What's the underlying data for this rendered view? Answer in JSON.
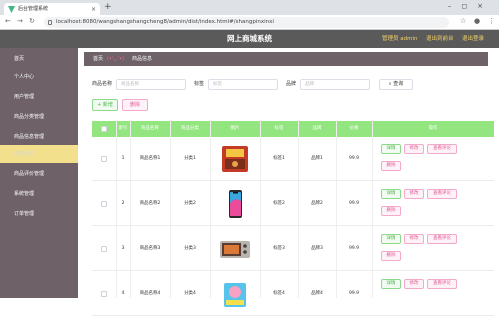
{
  "browser": {
    "tab_title": "后台管理系统",
    "url": "localhost:8080/wangshangshangcheng8/admin/dist/index.html#/shangpinxinxi"
  },
  "header": {
    "title": "网上商城系统",
    "user_label": "管理员 admin",
    "exit_to_front": "退出到前台",
    "logout": "退出登录"
  },
  "sidebar": {
    "items": [
      {
        "label": "首页"
      },
      {
        "label": "个人中心"
      },
      {
        "label": "用户管理"
      },
      {
        "label": "商品分类管理"
      },
      {
        "label": "商品信息管理"
      },
      {
        "label": "商品信息"
      },
      {
        "label": "商品评价管理"
      },
      {
        "label": "系统管理"
      },
      {
        "label": "订单管理"
      }
    ]
  },
  "breadcrumb": {
    "home": "首页",
    "separator": "(•'◡'•)",
    "current": "商品信息"
  },
  "search": {
    "name_label": "商品名称",
    "name_placeholder": "商品名称",
    "tag_label": "标签",
    "tag_placeholder": "标签",
    "brand_label": "品牌",
    "brand_placeholder": "品牌",
    "query_button": "查询"
  },
  "actions": {
    "add": "+ 新增",
    "delete": "删除"
  },
  "table": {
    "headers": [
      "索引",
      "商品名称",
      "商品分类",
      "图片",
      "标签",
      "品牌",
      "价格",
      "操作"
    ],
    "row_buttons": {
      "detail": "详情",
      "edit": "修改",
      "review": "查看评论",
      "delete": "删除"
    },
    "rows": [
      {
        "index": "1",
        "name": "商品名称1",
        "category": "分类1",
        "image": "food-package",
        "tag": "标签1",
        "brand": "品牌1",
        "price": "99.9"
      },
      {
        "index": "2",
        "name": "商品名称2",
        "category": "分类2",
        "image": "smartphone",
        "tag": "标签2",
        "brand": "品牌2",
        "price": "99.9"
      },
      {
        "index": "3",
        "name": "商品名称3",
        "category": "分类3",
        "image": "oven",
        "tag": "标签3",
        "brand": "品牌3",
        "price": "99.9"
      },
      {
        "index": "4",
        "name": "商品名称4",
        "category": "分类4",
        "image": "toy-box",
        "tag": "标签4",
        "brand": "品牌4",
        "price": "99.9"
      }
    ]
  },
  "colors": {
    "header_bg": "#5a5a5a",
    "sidebar_bg": "#6e6168",
    "sidebar_active": "#f2e08c",
    "table_header": "#93e57f",
    "accent_green": "#49b946",
    "accent_pink": "#e35a97",
    "header_link": "#f2d36a"
  }
}
